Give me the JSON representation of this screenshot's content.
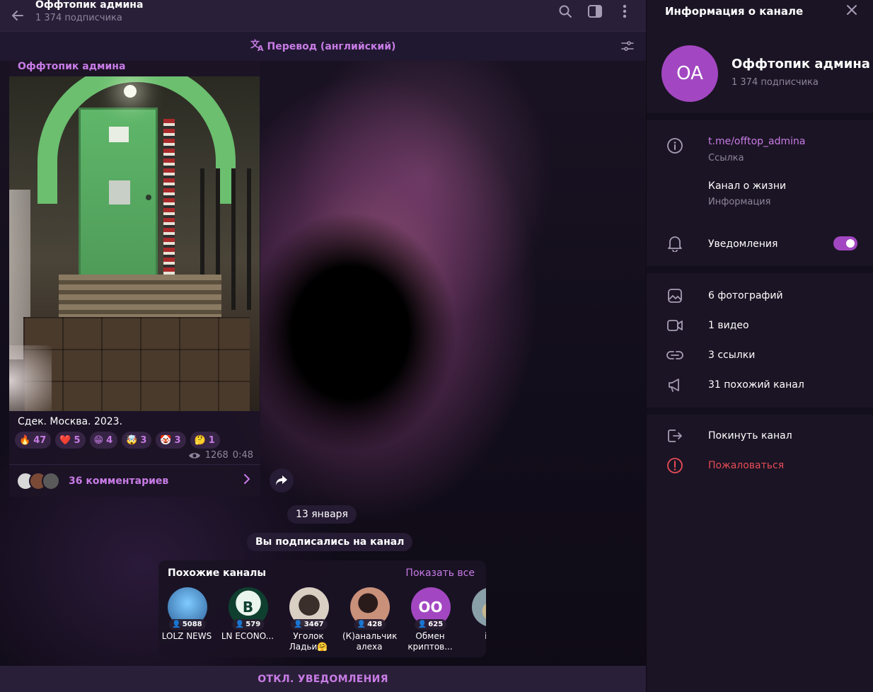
{
  "header": {
    "title": "Оффтопик админа",
    "subscribers": "1 374 подписчика",
    "icons": [
      "back-arrow-icon",
      "search-icon",
      "sidebar-toggle-icon",
      "more-vertical-icon"
    ]
  },
  "translate_bar": {
    "label": "Перевод (английский)",
    "icons": [
      "translate-icon",
      "settings-sliders-icon"
    ]
  },
  "post": {
    "author": "Оффтопик админа",
    "caption": "Сдек. Москва. 2023.",
    "reactions": [
      {
        "emoji": "🔥",
        "count": "47"
      },
      {
        "emoji": "❤️",
        "count": "5"
      },
      {
        "emoji": "😁",
        "count": "4"
      },
      {
        "emoji": "🤯",
        "count": "3"
      },
      {
        "emoji": "🤡",
        "count": "3"
      },
      {
        "emoji": "🤔",
        "count": "1"
      }
    ],
    "views": "1268",
    "time": "0:48",
    "comments_label": "36 комментариев"
  },
  "service": {
    "date": "13 января",
    "subscribed": "Вы подписались на канал"
  },
  "similar_channels": {
    "title": "Похожие каналы",
    "show_all": "Показать все",
    "items": [
      {
        "name": "LOLZ NEWS",
        "count": "5088",
        "color": "#3f7fb8",
        "initials": ""
      },
      {
        "name": "LN ECONO...",
        "count": "579",
        "color": "#0f3f2f",
        "initials": "B"
      },
      {
        "name": "Уголок Ладьи🤗",
        "count": "3467",
        "color": "#d9cfc3",
        "initials": ""
      },
      {
        "name": "(К)анальчик алеха",
        "count": "428",
        "color": "#c9907a",
        "initials": ""
      },
      {
        "name": "Обмен криптов...",
        "count": "625",
        "color": "#a247c1",
        "initials": "ОО"
      },
      {
        "name": "iva",
        "count": "",
        "color": "#8aa0a8",
        "initials": ""
      }
    ]
  },
  "bottom_bar": {
    "label": "ОТКЛ. УВЕДОМЛЕНИЯ"
  },
  "panel": {
    "title": "Информация о канале",
    "avatar_initials": "OA",
    "name": "Оффтопик админа",
    "subscribers": "1 374 подписчика",
    "link": "t.me/offtop_admina",
    "link_label": "Ссылка",
    "description": "Канал о жизни",
    "description_label": "Информация",
    "notifications": "Уведомления",
    "notifications_on": true,
    "media": {
      "photos": "6 фотографий",
      "videos": "1 видео",
      "links": "3 ссылки",
      "similar": "31 похожий канал"
    },
    "leave": "Покинуть канал",
    "report": "Пожаловаться"
  },
  "colors": {
    "accent": "#c87ce6",
    "avatar": "#a247c1",
    "danger": "#e74c57",
    "header_bg": "#2a1f38",
    "panel_bg": "#1b1424"
  }
}
